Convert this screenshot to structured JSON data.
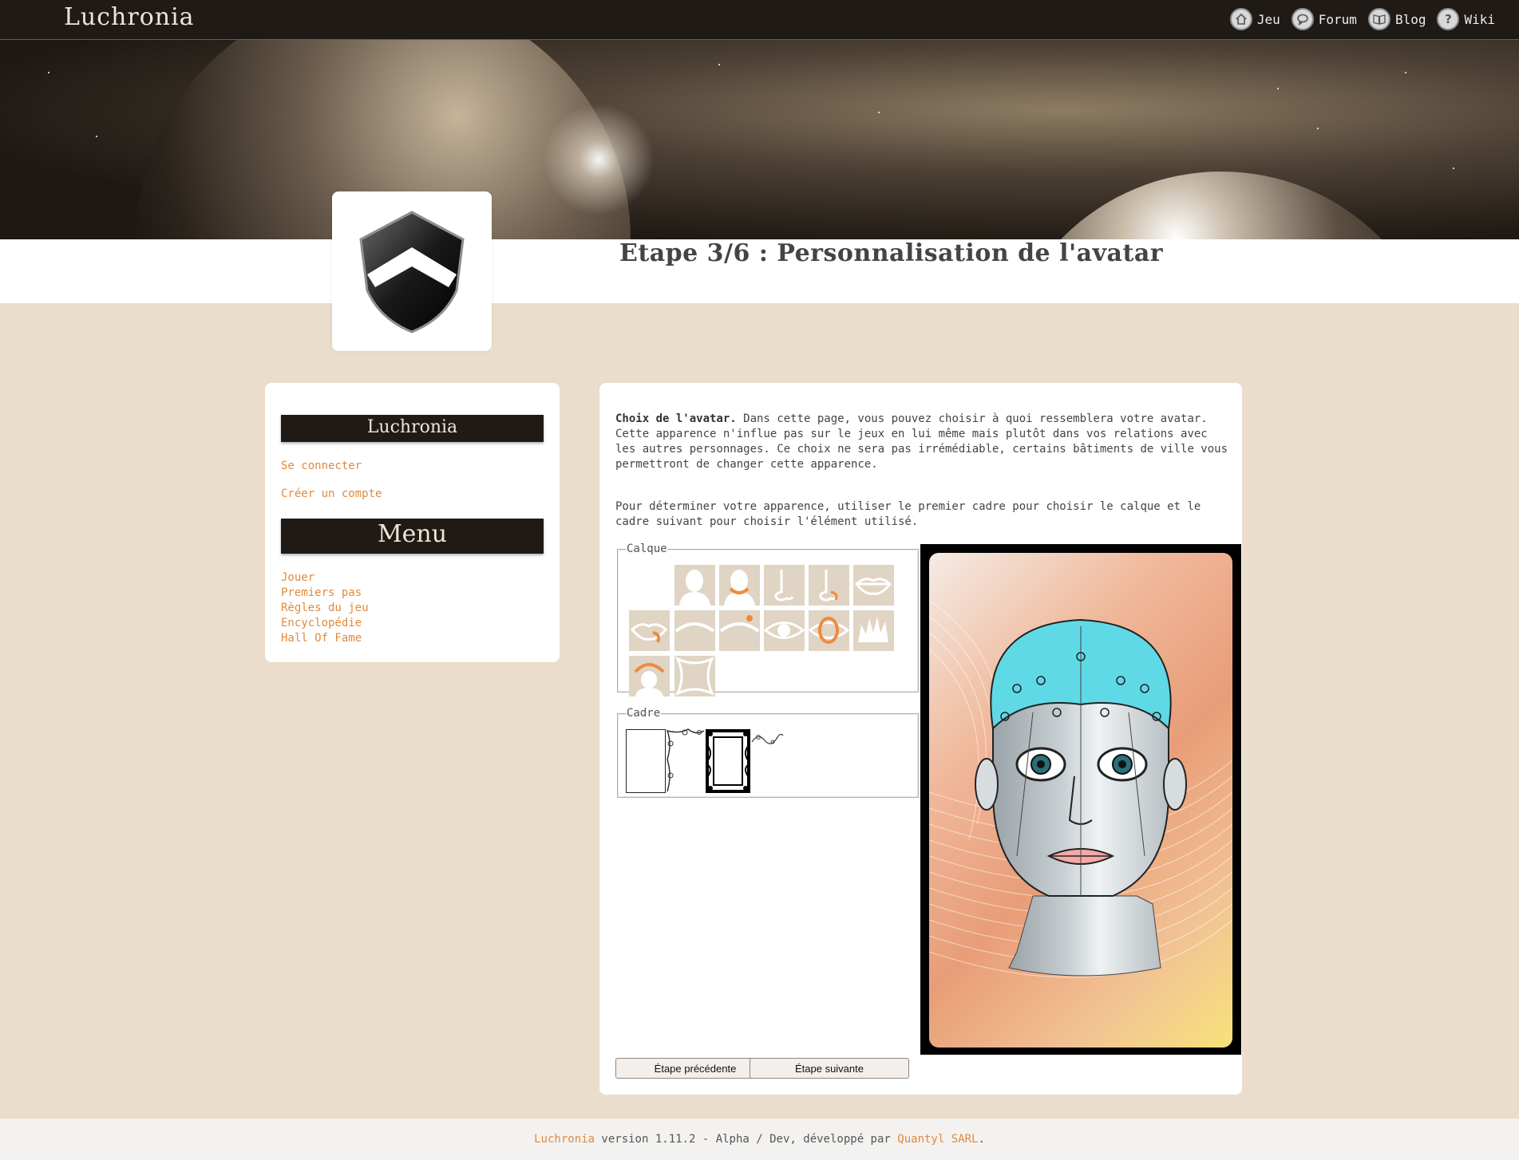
{
  "site": {
    "title": "Luchronia"
  },
  "topnav": [
    {
      "label": "Jeu",
      "icon": "home-icon"
    },
    {
      "label": "Forum",
      "icon": "chat-icon"
    },
    {
      "label": "Blog",
      "icon": "book-icon"
    },
    {
      "label": "Wiki",
      "icon": "help-icon"
    }
  ],
  "page": {
    "title": "Etape 3/6 : Personnalisation de l'avatar"
  },
  "sidebar": {
    "section1_title": "Luchronia",
    "login_link": "Se connecter",
    "register_link": "Créer un compte",
    "section2_title": "Menu",
    "menu": [
      "Jouer",
      "Premiers pas",
      "Règles du jeu",
      "Encyclopédie",
      "Hall Of Fame"
    ]
  },
  "main": {
    "intro_bold": "Choix de l'avatar.",
    "intro_text": " Dans cette page, vous pouvez choisir à quoi ressemblera votre avatar. Cette apparence n'influe pas sur le jeux en lui même mais plutôt dans vos relations avec les autres personnages. Ce choix ne sera pas irrémédiable, certains bâtiments de ville vous permettront de changer cette apparence.",
    "instructions": "Pour déterminer votre apparence, utiliser le premier cadre pour choisir le calque et le cadre suivant pour choisir l'élément utilisé.",
    "layer_legend": "Calque",
    "frame_legend": "Cadre",
    "prev_button": "Étape précédente",
    "next_button": "Étape suivante"
  },
  "footer": {
    "brand": "Luchronia",
    "text": " version 1.11.2 - Alpha / Dev, développé par ",
    "company": "Quantyl SARL",
    "end": "."
  },
  "colors": {
    "accent": "#e08a3c",
    "dark": "#1f1a15",
    "background": "#eaddcb"
  }
}
